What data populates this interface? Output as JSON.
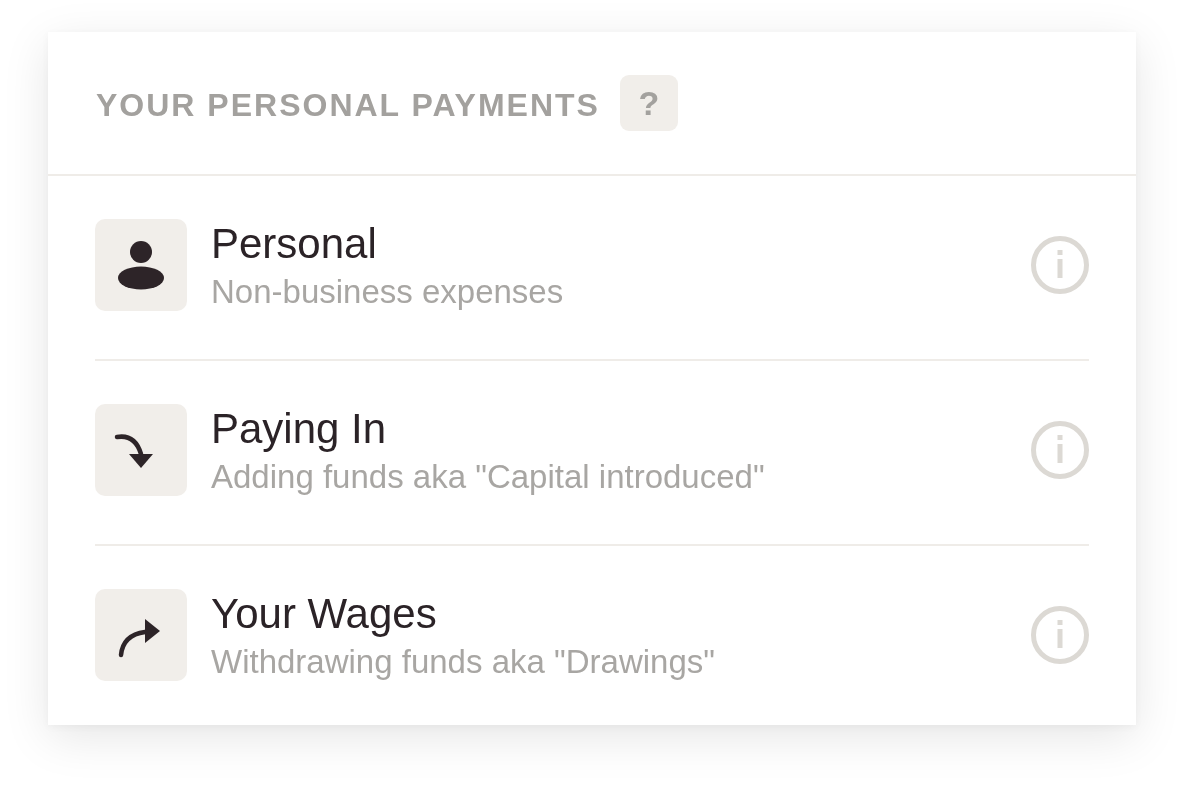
{
  "panel": {
    "title": "YOUR PERSONAL PAYMENTS",
    "help": "?",
    "items": [
      {
        "kind": "person",
        "title": "Personal",
        "subtitle": "Non-business expenses"
      },
      {
        "kind": "in",
        "title": "Paying In",
        "subtitle": "Adding funds aka \"Capital introduced\""
      },
      {
        "kind": "out",
        "title": "Your Wages",
        "subtitle": "Withdrawing funds aka \"Drawings\""
      }
    ]
  }
}
